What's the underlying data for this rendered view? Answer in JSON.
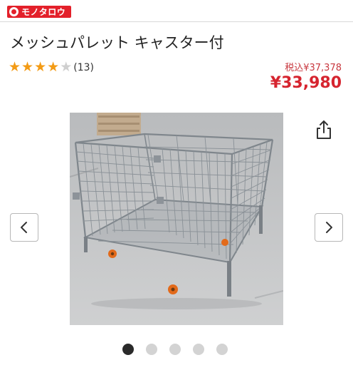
{
  "header": {
    "logo_text": "モノタロウ",
    "logo_color": "#e3202a"
  },
  "product": {
    "title": "メッシュパレット キャスター付",
    "rating": {
      "stars": [
        "★",
        "★",
        "★",
        "★",
        "★"
      ],
      "value": 4,
      "max": 5,
      "count_label": "(13)"
    },
    "price_tax_included": "税込¥37,378",
    "price": "¥33,980",
    "price_color": "#d6242f"
  },
  "icons": {
    "share": "share-icon",
    "prev": "chevron-left-icon",
    "next": "chevron-right-icon"
  },
  "gallery": {
    "total_images": 5,
    "active_index": 0
  }
}
